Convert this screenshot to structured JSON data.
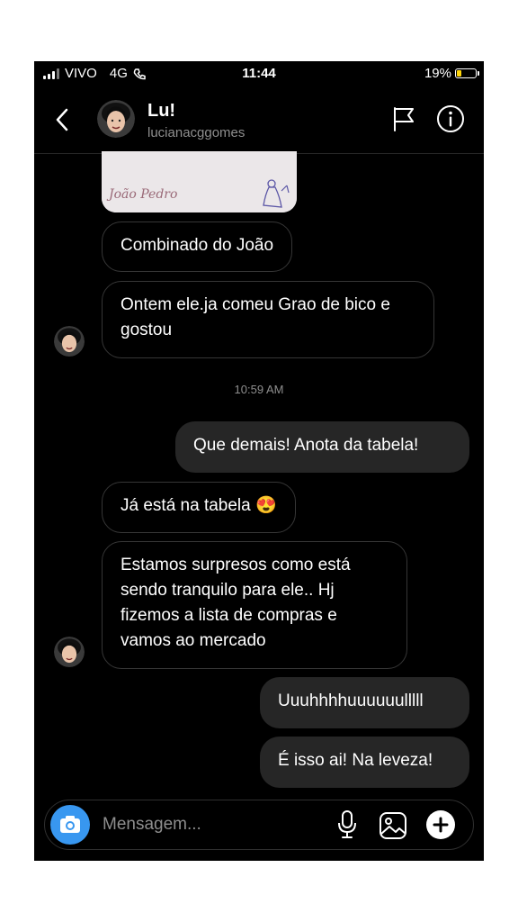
{
  "status_bar": {
    "carrier": "VIVO",
    "network": "4G",
    "time": "11:44",
    "battery": "19%",
    "battery_color": "#ffd60a"
  },
  "header": {
    "name": "Lu!",
    "username": "lucianacggomes",
    "back_icon": "chevron-left-icon",
    "flag_icon": "flag-icon",
    "info_icon": "info-icon"
  },
  "photo_message": {
    "handwriting": "João Pedro"
  },
  "messages": [
    {
      "side": "in",
      "text": "Combinado do João"
    },
    {
      "side": "in",
      "text": "Ontem ele.ja comeu Grao de bico e gostou"
    },
    {
      "side": "out",
      "text": "Que demais! Anota da tabela!"
    },
    {
      "side": "in",
      "text": "Já está na tabela 😍"
    },
    {
      "side": "in",
      "text": "Estamos surpresos como está sendo tranquilo para ele.. Hj fizemos a lista de compras e vamos ao mercado"
    },
    {
      "side": "out",
      "text": "Uuuhhhhuuuuuulllll"
    },
    {
      "side": "out",
      "text": "É isso ai! Na leveza!"
    }
  ],
  "timestamp": "10:59 AM",
  "composer": {
    "placeholder": "Mensagem...",
    "camera_color": "#3897f0",
    "icons": [
      "camera-icon",
      "microphone-icon",
      "gallery-icon",
      "plus-icon"
    ]
  }
}
